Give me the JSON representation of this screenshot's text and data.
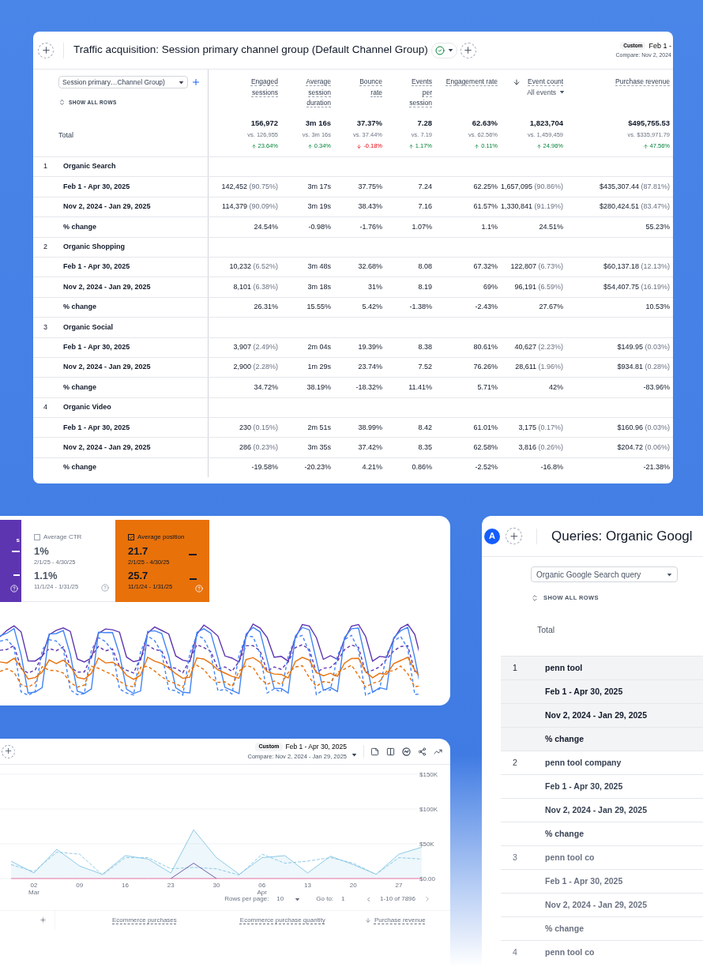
{
  "traffic_report": {
    "title": "Traffic acquisition: Session primary channel group (Default Channel Group)",
    "date_badge": "Custom",
    "date_range": "Feb 1 -",
    "compare": "Compare: Nov 2, 2024",
    "dimension": "Session primary…Channel Group)",
    "show_rows": "SHOW ALL ROWS",
    "columns": [
      {
        "label": "Engaged sessions",
        "sorted": false
      },
      {
        "label": "Average session duration",
        "sorted": false
      },
      {
        "label": "Bounce rate",
        "sorted": false
      },
      {
        "label": "Events per session",
        "sorted": false
      },
      {
        "label": "Engagement rate",
        "sorted": false
      },
      {
        "label": "Event count",
        "sorted": true,
        "sublabel": "All events"
      },
      {
        "label": "Purchase revenue",
        "sorted": false
      }
    ],
    "total": {
      "label": "Total",
      "cells": [
        {
          "value": "156,972",
          "compare": "vs. 126,955",
          "change": "23.64%",
          "increase": true
        },
        {
          "value": "3m 16s",
          "compare": "vs. 3m 16s",
          "change": "0.34%",
          "increase": true
        },
        {
          "value": "37.37%",
          "compare": "vs. 37.44%",
          "change": "-0.18%",
          "increase": false
        },
        {
          "value": "7.28",
          "compare": "vs. 7.19",
          "change": "1.17%",
          "increase": true
        },
        {
          "value": "62.63%",
          "compare": "vs. 62.56%",
          "change": "0.11%",
          "increase": true
        },
        {
          "value": "1,823,704",
          "compare": "vs. 1,459,459",
          "change": "24.96%",
          "increase": true
        },
        {
          "value": "$495,755.53",
          "compare": "vs. $335,971.79",
          "change": "47.56%",
          "increase": true
        }
      ]
    },
    "groups": [
      {
        "index": "1",
        "name": "Organic Search",
        "rows": [
          {
            "label": "Feb 1 - Apr 30, 2025",
            "cells": [
              {
                "value": "142,452",
                "share": "(90.75%)"
              },
              {
                "value": "3m 17s"
              },
              {
                "value": "37.75%"
              },
              {
                "value": "7.24"
              },
              {
                "value": "62.25%"
              },
              {
                "value": "1,657,095",
                "share": "(90.86%)"
              },
              {
                "value": "$435,307.44",
                "share": "(87.81%)"
              }
            ]
          },
          {
            "label": "Nov 2, 2024 - Jan 29, 2025",
            "cells": [
              {
                "value": "114,379",
                "share": "(90.09%)"
              },
              {
                "value": "3m 19s"
              },
              {
                "value": "38.43%"
              },
              {
                "value": "7.16"
              },
              {
                "value": "61.57%"
              },
              {
                "value": "1,330,841",
                "share": "(91.19%)"
              },
              {
                "value": "$280,424.51",
                "share": "(83.47%)"
              }
            ]
          },
          {
            "label": "% change",
            "cells": [
              {
                "value": "24.54%"
              },
              {
                "value": "-0.98%"
              },
              {
                "value": "-1.76%"
              },
              {
                "value": "1.07%"
              },
              {
                "value": "1.1%"
              },
              {
                "value": "24.51%"
              },
              {
                "value": "55.23%"
              }
            ]
          }
        ]
      },
      {
        "index": "2",
        "name": "Organic Shopping",
        "rows": [
          {
            "label": "Feb 1 - Apr 30, 2025",
            "cells": [
              {
                "value": "10,232",
                "share": "(6.52%)"
              },
              {
                "value": "3m 48s"
              },
              {
                "value": "32.68%"
              },
              {
                "value": "8.08"
              },
              {
                "value": "67.32%"
              },
              {
                "value": "122,807",
                "share": "(6.73%)"
              },
              {
                "value": "$60,137.18",
                "share": "(12.13%)"
              }
            ]
          },
          {
            "label": "Nov 2, 2024 - Jan 29, 2025",
            "cells": [
              {
                "value": "8,101",
                "share": "(6.38%)"
              },
              {
                "value": "3m 18s"
              },
              {
                "value": "31%"
              },
              {
                "value": "8.19"
              },
              {
                "value": "69%"
              },
              {
                "value": "96,191",
                "share": "(6.59%)"
              },
              {
                "value": "$54,407.75",
                "share": "(16.19%)"
              }
            ]
          },
          {
            "label": "% change",
            "cells": [
              {
                "value": "26.31%"
              },
              {
                "value": "15.55%"
              },
              {
                "value": "5.42%"
              },
              {
                "value": "-1.38%"
              },
              {
                "value": "-2.43%"
              },
              {
                "value": "27.67%"
              },
              {
                "value": "10.53%"
              }
            ]
          }
        ]
      },
      {
        "index": "3",
        "name": "Organic Social",
        "rows": [
          {
            "label": "Feb 1 - Apr 30, 2025",
            "cells": [
              {
                "value": "3,907",
                "share": "(2.49%)"
              },
              {
                "value": "2m 04s"
              },
              {
                "value": "19.39%"
              },
              {
                "value": "8.38"
              },
              {
                "value": "80.61%"
              },
              {
                "value": "40,627",
                "share": "(2.23%)"
              },
              {
                "value": "$149.95",
                "share": "(0.03%)"
              }
            ]
          },
          {
            "label": "Nov 2, 2024 - Jan 29, 2025",
            "cells": [
              {
                "value": "2,900",
                "share": "(2.28%)"
              },
              {
                "value": "1m 29s"
              },
              {
                "value": "23.74%"
              },
              {
                "value": "7.52"
              },
              {
                "value": "76.26%"
              },
              {
                "value": "28,611",
                "share": "(1.96%)"
              },
              {
                "value": "$934.81",
                "share": "(0.28%)"
              }
            ]
          },
          {
            "label": "% change",
            "cells": [
              {
                "value": "34.72%"
              },
              {
                "value": "38.19%"
              },
              {
                "value": "-18.32%"
              },
              {
                "value": "11.41%"
              },
              {
                "value": "5.71%"
              },
              {
                "value": "42%"
              },
              {
                "value": "-83.96%"
              }
            ]
          }
        ]
      },
      {
        "index": "4",
        "name": "Organic Video",
        "rows": [
          {
            "label": "Feb 1 - Apr 30, 2025",
            "cells": [
              {
                "value": "230",
                "share": "(0.15%)"
              },
              {
                "value": "2m 51s"
              },
              {
                "value": "38.99%"
              },
              {
                "value": "8.42"
              },
              {
                "value": "61.01%"
              },
              {
                "value": "3,175",
                "share": "(0.17%)"
              },
              {
                "value": "$160.96",
                "share": "(0.03%)"
              }
            ]
          },
          {
            "label": "Nov 2, 2024 - Jan 29, 2025",
            "cells": [
              {
                "value": "286",
                "share": "(0.23%)"
              },
              {
                "value": "3m 35s"
              },
              {
                "value": "37.42%"
              },
              {
                "value": "8.35"
              },
              {
                "value": "62.58%"
              },
              {
                "value": "3,816",
                "share": "(0.26%)"
              },
              {
                "value": "$204.72",
                "share": "(0.06%)"
              }
            ]
          },
          {
            "label": "% change",
            "cells": [
              {
                "value": "-19.58%"
              },
              {
                "value": "-20.23%"
              },
              {
                "value": "4.21%"
              },
              {
                "value": "0.86%"
              },
              {
                "value": "-2.52%"
              },
              {
                "value": "-16.8%"
              },
              {
                "value": "-21.38%"
              }
            ]
          }
        ]
      }
    ]
  },
  "search_performance": {
    "cards": [
      {
        "label": "s",
        "selected": true,
        "color": "#5e35b1"
      },
      {
        "label": "Average CTR",
        "selected": false,
        "checked": false,
        "color": "#ffffff",
        "value": "1%",
        "range": "2/1/25 - 4/30/25",
        "prev_value": "1.1%",
        "prev_range": "11/1/24 - 1/31/25"
      },
      {
        "label": "Average position",
        "selected": true,
        "checked": true,
        "color": "#e8710a",
        "value": "21.7",
        "range": "2/1/25 - 4/30/25",
        "prev_value": "25.7",
        "prev_range": "11/1/24 - 1/31/25"
      }
    ]
  },
  "queries_report": {
    "avatar": "A",
    "title": "Queries: Organic Googl",
    "dimension": "Organic Google Search query",
    "show_rows": "SHOW ALL ROWS",
    "total": "Total",
    "groups": [
      {
        "index": "1",
        "name": "penn tool",
        "highlighted": true,
        "rows": [
          "Feb 1 - Apr 30, 2025",
          "Nov 2, 2024 - Jan 29, 2025",
          "% change"
        ]
      },
      {
        "index": "2",
        "name": "penn tool company",
        "highlighted": false,
        "rows": [
          "Feb 1 - Apr 30, 2025",
          "Nov 2, 2024 - Jan 29, 2025",
          "% change"
        ]
      },
      {
        "index": "3",
        "name": "penn tool co",
        "highlighted": false,
        "rows": [
          "Feb 1 - Apr 30, 2025",
          "Nov 2, 2024 - Jan 29, 2025",
          "% change"
        ]
      },
      {
        "index": "4",
        "name": "penn tool co",
        "highlighted": false
      }
    ]
  },
  "revenue_report": {
    "date_badge": "Custom",
    "date_range": "Feb 1 - Apr 30, 2025",
    "compare": "Compare: Nov 2, 2024 - Jan 29, 2025",
    "chart_data": {
      "type": "area",
      "ylim": [
        0,
        150
      ],
      "yticks": [
        {
          "value": 0,
          "label": "$0.00"
        },
        {
          "value": 50,
          "label": "$50K"
        },
        {
          "value": 100,
          "label": "$100K"
        },
        {
          "value": 150,
          "label": "$150K"
        }
      ],
      "categories": [
        null,
        "02",
        null,
        "09",
        null,
        "16",
        null,
        "23",
        null,
        "30",
        null,
        "06",
        null,
        "13",
        null,
        "20",
        null,
        "27",
        null
      ],
      "annotations": [
        "Mar",
        "Apr"
      ],
      "series": [
        {
          "color": "#8ecae6",
          "type": "area",
          "values": [
            25,
            8,
            42,
            18,
            6,
            33,
            28,
            8,
            70,
            30,
            6,
            30,
            33,
            8,
            32,
            20,
            6,
            35,
            45
          ]
        },
        {
          "color": "#8ecae6",
          "type": "line",
          "line_style": "dashed",
          "values": [
            20,
            10,
            38,
            35,
            5,
            30,
            30,
            14,
            16,
            14,
            5,
            35,
            22,
            25,
            30,
            22,
            6,
            30,
            28
          ]
        },
        {
          "color": "#e879a8",
          "type": "line",
          "values": [
            0,
            0,
            0,
            0,
            0,
            0,
            0,
            0,
            0,
            0,
            0,
            0,
            0,
            0,
            0,
            0,
            0,
            0,
            0
          ]
        },
        {
          "color": "#6f5fa8",
          "type": "line",
          "values": [
            null,
            null,
            null,
            null,
            null,
            null,
            null,
            0,
            22,
            0,
            null,
            null,
            null,
            null,
            null,
            null,
            null,
            null,
            null
          ]
        }
      ]
    },
    "pagination": {
      "rows_label": "Rows per page:",
      "rows_value": "10",
      "goto_label": "Go to:",
      "goto_value": "1",
      "range": "1-10 of 7896"
    },
    "columns": [
      {
        "label": "Ecommerce purchases",
        "sorted": false
      },
      {
        "label": "Ecommerce purchase quantity",
        "sorted": false
      },
      {
        "label": "Purchase revenue",
        "sorted": true
      }
    ]
  }
}
